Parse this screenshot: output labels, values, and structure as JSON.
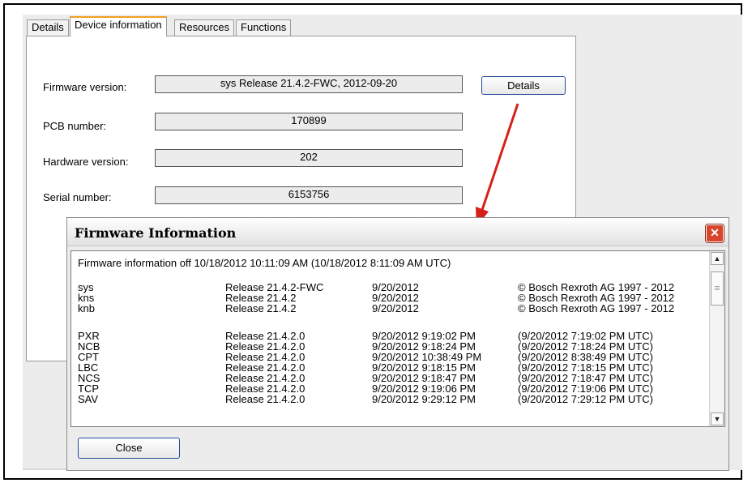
{
  "tabs": [
    {
      "label": "Details"
    },
    {
      "label": "Device information"
    },
    {
      "label": "Resources"
    },
    {
      "label": "Functions"
    }
  ],
  "device_info": {
    "firmware_label": "Firmware version:",
    "firmware_value": "sys Release 21.4.2-FWC, 2012-09-20",
    "details_button": "Details",
    "pcb_label": "PCB number:",
    "pcb_value": "170899",
    "hardware_label": "Hardware version:",
    "hardware_value": "202",
    "serial_label": "Serial number:",
    "serial_value": "6153756"
  },
  "dialog": {
    "title": "Firmware Information",
    "close_glyph": "✕",
    "header": "Firmware information off 10/18/2012 10:11:09 AM  (10/18/2012 8:11:09 AM UTC)",
    "close_button": "Close",
    "rows": [
      [
        "sys",
        "Release 21.4.2-FWC",
        "9/20/2012",
        "© Bosch Rexroth AG 1997 - 2012"
      ],
      [
        "kns",
        "Release 21.4.2",
        "9/20/2012",
        "© Bosch Rexroth AG 1997 - 2012"
      ],
      [
        "knb",
        "Release 21.4.2",
        "9/20/2012",
        "© Bosch Rexroth AG 1997 - 2012"
      ],
      [
        "PXR",
        "Release 21.4.2.0",
        "9/20/2012 9:19:02 PM",
        "(9/20/2012 7:19:02 PM UTC)"
      ],
      [
        "NCB",
        "Release 21.4.2.0",
        "9/20/2012 9:18:24 PM",
        "(9/20/2012 7:18:24 PM UTC)"
      ],
      [
        "CPT",
        "Release 21.4.2.0",
        "9/20/2012 10:38:49 PM",
        "(9/20/2012 8:38:49 PM UTC)"
      ],
      [
        "LBC",
        "Release 21.4.2.0",
        "9/20/2012 9:18:15 PM",
        "(9/20/2012 7:18:15 PM UTC)"
      ],
      [
        "NCS",
        "Release 21.4.2.0",
        "9/20/2012 9:18:47 PM",
        "(9/20/2012 7:18:47 PM UTC)"
      ],
      [
        "TCP",
        "Release 21.4.2.0",
        "9/20/2012 9:19:06 PM",
        "(9/20/2012 7:19:06 PM UTC)"
      ],
      [
        "SAV",
        "Release 21.4.2.0",
        "9/20/2012 9:29:12 PM",
        "(9/20/2012 7:29:12 PM UTC)"
      ]
    ]
  },
  "icons": {
    "scroll_up": "chevron-up-icon",
    "scroll_down": "chevron-down-icon",
    "arrow": "red-arrow-annotation"
  },
  "colors": {
    "active_tab_accent": "#f0a020",
    "close_button_red": "#d9452b",
    "arrow_red": "#d6201a",
    "button_border": "#244c9a"
  }
}
